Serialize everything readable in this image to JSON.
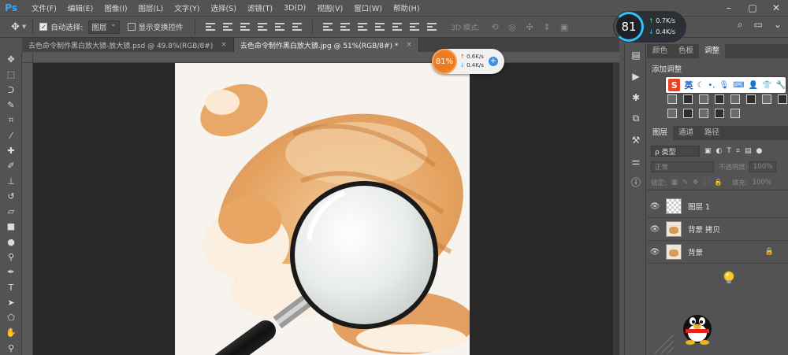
{
  "app": {
    "logo": "Ps"
  },
  "menu": [
    "文件(F)",
    "编辑(E)",
    "图像(I)",
    "图层(L)",
    "文字(Y)",
    "选择(S)",
    "滤镜(T)",
    "3D(D)",
    "视图(V)",
    "窗口(W)",
    "帮助(H)"
  ],
  "options": {
    "auto_select_label": "自动选择:",
    "auto_select_value": "图层",
    "show_transform_label": "显示变换控件",
    "mode_3d_label": "3D 模式:"
  },
  "speed": {
    "percent": "81",
    "up": "0.7K/s",
    "down": "0.4K/s"
  },
  "tabs": [
    {
      "label": "去色命令制作黑白放大镜-放大镜.psd @ 49.8%(RGB/8#)",
      "close": "×"
    },
    {
      "label": "去色命令制作黑白放大镜.jpg @ 51%(RGB/8#) *",
      "close": "×"
    }
  ],
  "badge": {
    "percent": "81%",
    "up": "0.6K/s",
    "down": "0.4K/s",
    "plus": "+"
  },
  "panels": {
    "top_tabs": [
      "颜色",
      "色板",
      "调整"
    ],
    "add_adjustment": "添加调整",
    "ime_lang": "英",
    "layer_tabs": [
      "图层",
      "通道",
      "路径"
    ],
    "filter_kind": "ρ 类型",
    "blend_mode": "正常",
    "opacity_label": "不透明度:",
    "opacity_value": "100%",
    "lock_label": "锁定:",
    "fill_label": "填充:",
    "fill_value": "100%"
  },
  "layers": [
    {
      "name": "图层 1",
      "type": "transparent",
      "locked": false
    },
    {
      "name": "背景 拷贝",
      "type": "photo",
      "locked": false
    },
    {
      "name": "背景",
      "type": "photo",
      "locked": true
    }
  ],
  "colors": {
    "ui_bg": "#535353",
    "canvas_bg": "#28282a",
    "accent": "#31a8ff",
    "badge_orange": "#f07b1c"
  }
}
